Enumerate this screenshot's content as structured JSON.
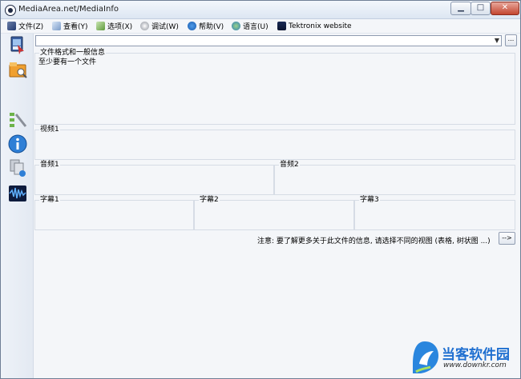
{
  "window": {
    "title": "MediaArea.net/MediaInfo",
    "controls": {
      "minimize": "▁",
      "maximize": "□",
      "close": "✕"
    }
  },
  "menu": [
    {
      "label": "文件(Z)",
      "icon": "file-icon"
    },
    {
      "label": "查看(Y)",
      "icon": "view-icon"
    },
    {
      "label": "选项(X)",
      "icon": "options-icon"
    },
    {
      "label": "调试(W)",
      "icon": "debug-icon"
    },
    {
      "label": "帮助(V)",
      "icon": "help-icon"
    },
    {
      "label": "语言(U)",
      "icon": "language-icon"
    },
    {
      "label": "Tektronix website",
      "icon": "tektronix-icon"
    }
  ],
  "sidebar": [
    {
      "name": "open-file",
      "icon": "open-file-icon"
    },
    {
      "name": "open-folder",
      "icon": "open-folder-icon"
    },
    {
      "name": "preferences",
      "icon": "preferences-icon"
    },
    {
      "name": "about",
      "icon": "info-icon"
    },
    {
      "name": "export",
      "icon": "export-icon"
    },
    {
      "name": "tektronix",
      "icon": "waveform-icon"
    }
  ],
  "file_select": {
    "value": "",
    "arrow": "▼",
    "browse_label": "..."
  },
  "groups": {
    "general": {
      "title": "文件格式和一般信息",
      "content": "至少要有一个文件"
    },
    "video1": {
      "title": "视频1"
    },
    "audio1": {
      "title": "音频1"
    },
    "audio2": {
      "title": "音频2"
    },
    "text1": {
      "title": "字幕1"
    },
    "text2": {
      "title": "字幕2"
    },
    "text3": {
      "title": "字幕3"
    }
  },
  "note": {
    "text": "注意: 要了解更多关于此文件的信息, 请选择不同的视图 (表格, 树状图 ...)",
    "next_label": "-->"
  },
  "watermark": {
    "title": "当客软件园",
    "url": "www.downkr.com"
  },
  "colors": {
    "accent": "#1f6fd0",
    "window_bg": "#f4f6f9",
    "border": "#d6dce5"
  }
}
